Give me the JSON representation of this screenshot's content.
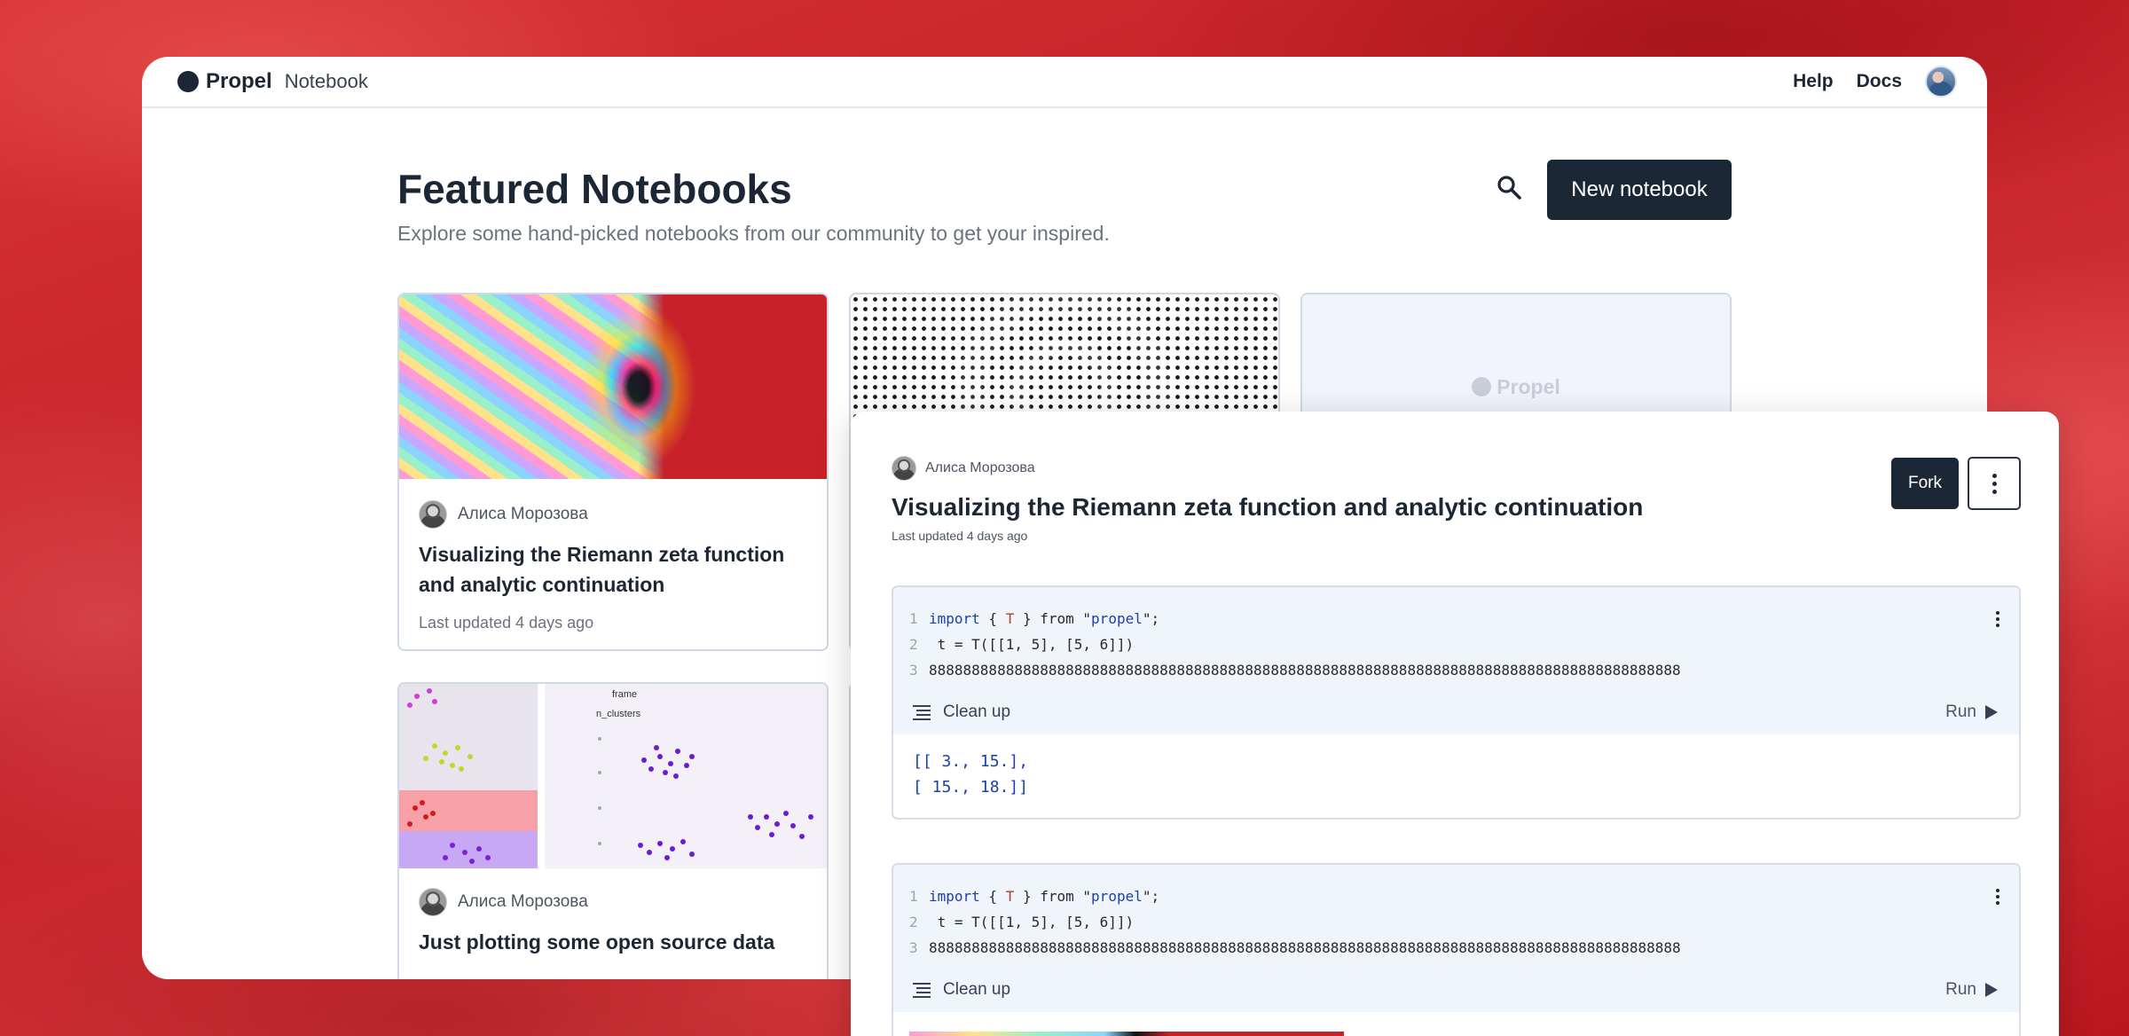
{
  "app": {
    "brand": "Propel",
    "section": "Notebook"
  },
  "nav": {
    "help": "Help",
    "docs": "Docs"
  },
  "page": {
    "title": "Featured Notebooks",
    "subtitle": "Explore some hand-picked notebooks from our community to get your inspired.",
    "new_notebook": "New notebook"
  },
  "cards": [
    {
      "author": "Алиса Морозова",
      "title": "Visualizing the Riemann zeta function and analytic continuation",
      "updated": "Last updated 4 days ago"
    },
    {
      "placeholder_brand": "Propel"
    },
    {
      "author": "Алиса Морозова",
      "title": "Just plotting some open source data",
      "thumb_labels": {
        "frame": "frame",
        "clusters": "n_clusters"
      }
    }
  ],
  "panel": {
    "author": "Алиса Морозова",
    "title": "Visualizing the Riemann zeta function and analytic continuation",
    "updated": "Last updated 4 days ago",
    "fork": "Fork",
    "cells": [
      {
        "lines": [
          {
            "num": "1",
            "kw": "import",
            "p1": " { ",
            "tk": "T",
            "p2": " } from \"",
            "str": "propel",
            "p3": "\";"
          },
          {
            "num": "2",
            "text": " t = T([[1, 5], [5, 6]])"
          },
          {
            "num": "3",
            "text": "8888888888888888888888888888888888888888888888888888888888888888888888888888888888888888"
          }
        ],
        "cleanup": "Clean up",
        "run": "Run",
        "output": [
          "[[ 3., 15.],",
          "[ 15., 18.]]"
        ]
      },
      {
        "lines": [
          {
            "num": "1",
            "kw": "import",
            "p1": " { ",
            "tk": "T",
            "p2": " } from \"",
            "str": "propel",
            "p3": "\";"
          },
          {
            "num": "2",
            "text": " t = T([[1, 5], [5, 6]])"
          },
          {
            "num": "3",
            "text": "8888888888888888888888888888888888888888888888888888888888888888888888888888888888888888"
          }
        ],
        "cleanup": "Clean up",
        "run": "Run"
      }
    ]
  },
  "colors": {
    "primary": "#1c2736",
    "background": "#c8242a",
    "code_bg": "#f0f4fb",
    "output_text": "#1d3faa"
  }
}
